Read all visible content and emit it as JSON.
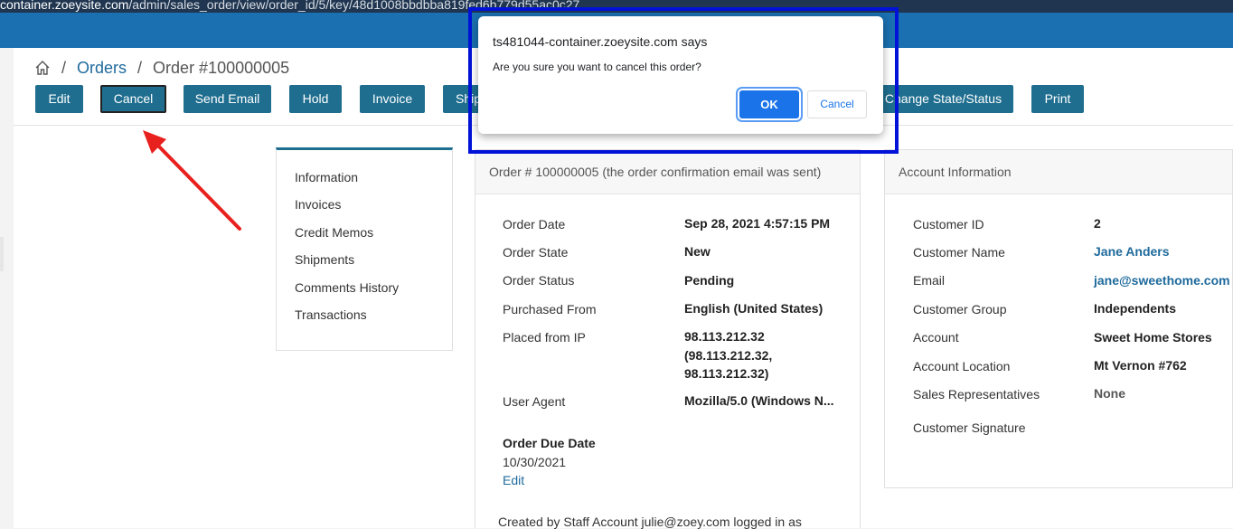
{
  "browser": {
    "url_host": "container.zoeysite.com",
    "url_path": "/admin/sales_order/view/order_id/5/key/48d1008bbdbba819fed6b779d55ac0c27"
  },
  "breadcrumb": {
    "orders": "Orders",
    "current": "Order #100000005"
  },
  "toolbar": {
    "edit": "Edit",
    "cancel": "Cancel",
    "send_email": "Send Email",
    "hold": "Hold",
    "invoice": "Invoice",
    "ship": "Ship",
    "change_state": "Change State/Status",
    "print": "Print"
  },
  "tabs": [
    "Information",
    "Invoices",
    "Credit Memos",
    "Shipments",
    "Comments History",
    "Transactions"
  ],
  "order_panel": {
    "header": "Order # 100000005 (the order confirmation email was sent)",
    "rows": [
      {
        "label": "Order Date",
        "value": "Sep 28, 2021 4:57:15 PM"
      },
      {
        "label": "Order State",
        "value": "New"
      },
      {
        "label": "Order Status",
        "value": "Pending"
      },
      {
        "label": "Purchased From",
        "value": "English (United States)"
      },
      {
        "label": "Placed from IP",
        "value_lines": [
          "98.113.212.32",
          "(98.113.212.32,",
          "98.113.212.32)"
        ]
      },
      {
        "label": "User Agent",
        "value": "Mozilla/5.0 (Windows N..."
      }
    ],
    "due_date_label": "Order Due Date",
    "due_date_value": "10/30/2021",
    "due_date_edit": "Edit",
    "footer": "Created by Staff Account julie@zoey.com logged in as"
  },
  "account_panel": {
    "header": "Account Information",
    "rows": [
      {
        "label": "Customer ID",
        "value": "2"
      },
      {
        "label": "Customer Name",
        "value": "Jane Anders"
      },
      {
        "label": "Email",
        "value": "jane@sweethome.com"
      },
      {
        "label": "Customer Group",
        "value": "Independents"
      },
      {
        "label": "Account",
        "value": "Sweet Home Stores"
      },
      {
        "label": "Account Location",
        "value": "Mt Vernon #762"
      },
      {
        "label": "Sales Representatives",
        "value": "None"
      },
      {
        "label": "Customer Signature",
        "value": ""
      }
    ]
  },
  "dialog": {
    "title": "ts481044-container.zoeysite.com says",
    "message": "Are you sure you want to cancel this order?",
    "ok": "OK",
    "cancel": "Cancel"
  },
  "colors": {
    "brand": "#1a70b0",
    "button": "#1f6e8f",
    "link": "#1e6a9c",
    "highlight": "#0012d8",
    "arrow": "#e8201e"
  }
}
